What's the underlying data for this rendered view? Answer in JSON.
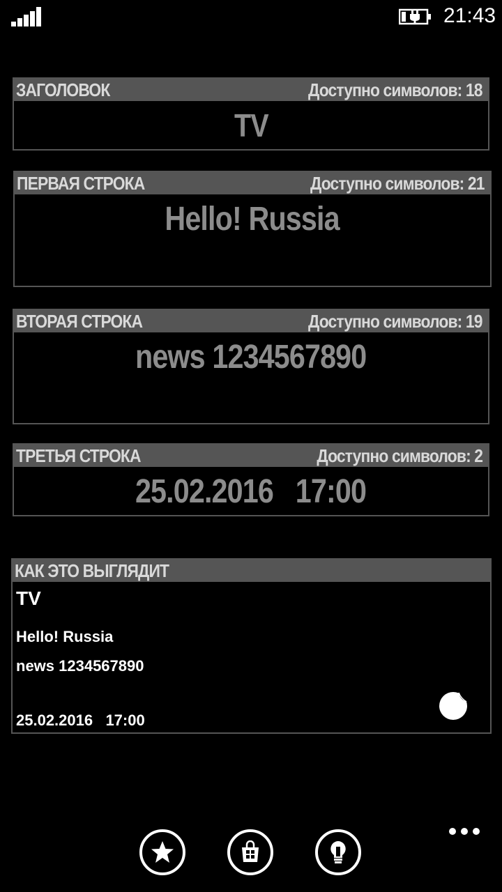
{
  "status_bar": {
    "time": "21:43",
    "signal_icon": "signal-strength-icon",
    "battery_icon": "battery-charging-icon"
  },
  "fields": [
    {
      "label": "ЗАГОЛОВОК",
      "available": "Доступно символов: 18",
      "value": "TV"
    },
    {
      "label": "ПЕРВАЯ СТРОКА",
      "available": "Доступно символов: 21",
      "value": "Hello! Russia"
    },
    {
      "label": "ВТОРАЯ СТРОКА",
      "available": "Доступно символов: 19",
      "value": "news 1234567890"
    },
    {
      "label": "ТРЕТЬЯ СТРОКА",
      "available": "Доступно символов: 2",
      "value": "25.02.2016   17:00"
    }
  ],
  "preview": {
    "label": "КАК ЭТО ВЫГЛЯДИТ",
    "title": "TV",
    "line1": "Hello! Russia",
    "line2": "news 1234567890",
    "line3": "25.02.2016   17:00",
    "icon": "moon-icon"
  },
  "app_bar": {
    "buttons": [
      "star-icon",
      "store-icon",
      "lightbulb-icon"
    ],
    "more_icon": "more-icon"
  },
  "colors": {
    "background": "#000000",
    "header_bg": "#555555",
    "header_text": "#d9d9d9",
    "value_text": "#8c8c8c"
  }
}
